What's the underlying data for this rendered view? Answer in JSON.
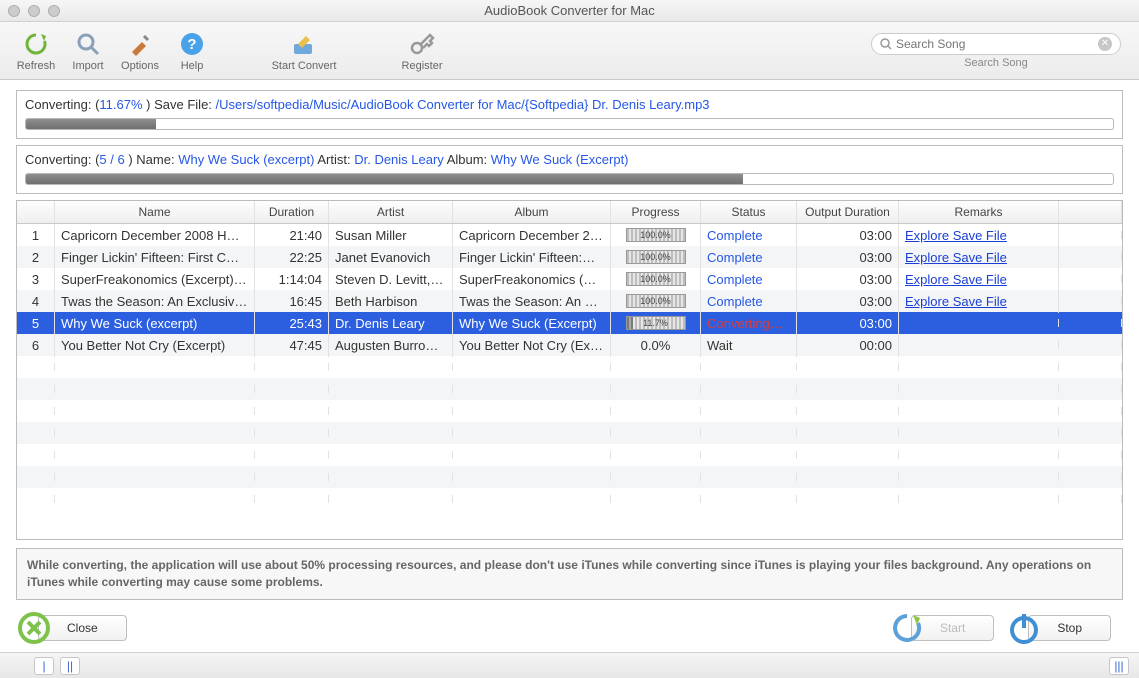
{
  "window": {
    "title": "AudioBook Converter for Mac"
  },
  "toolbar": {
    "refresh": "Refresh",
    "import": "Import",
    "options": "Options",
    "help": "Help",
    "start_convert": "Start Convert",
    "register": "Register"
  },
  "search": {
    "placeholder": "Search Song",
    "label": "Search Song"
  },
  "progress1": {
    "prefix": "Converting: (",
    "percent": "11.67%",
    "suffix": " ) Save File: ",
    "path": "/Users/softpedia/Music/AudioBook Converter for Mac/{Softpedia} Dr. Denis Leary.mp3",
    "bar_pct": 12
  },
  "progress2": {
    "prefix": "Converting: (",
    "count": "5 / 6",
    "suffix1": " )  Name: ",
    "name": "Why We Suck (excerpt)",
    "artist_label": "  Artist: ",
    "artist": "Dr. Denis Leary",
    "album_label": "  Album: ",
    "album": "Why We Suck (Excerpt)",
    "bar_pct": 66
  },
  "columns": {
    "idx": "",
    "name": "Name",
    "duration": "Duration",
    "artist": "Artist",
    "album": "Album",
    "progress": "Progress",
    "status": "Status",
    "output": "Output Duration",
    "remarks": "Remarks"
  },
  "rows": [
    {
      "idx": "1",
      "name": "Capricorn December 2008 H…",
      "dur": "21:40",
      "artist": "Susan Miller",
      "album": "Capricorn December 2…",
      "prog": "100.0%",
      "status": "Complete",
      "status_cls": "complete",
      "out": "03:00",
      "rem": "Explore Save File",
      "sel": false
    },
    {
      "idx": "2",
      "name": "Finger Lickin' Fifteen: First C…",
      "dur": "22:25",
      "artist": "Janet Evanovich",
      "album": "Finger Lickin' Fifteen:…",
      "prog": "100.0%",
      "status": "Complete",
      "status_cls": "complete",
      "out": "03:00",
      "rem": "Explore Save File",
      "sel": false
    },
    {
      "idx": "3",
      "name": "SuperFreakonomics (Excerpt)…",
      "dur": "1:14:04",
      "artist": "Steven D. Levitt,…",
      "album": "SuperFreakonomics (E…",
      "prog": "100.0%",
      "status": "Complete",
      "status_cls": "complete",
      "out": "03:00",
      "rem": "Explore Save File",
      "sel": false
    },
    {
      "idx": "4",
      "name": "Twas the Season: An Exclusiv…",
      "dur": "16:45",
      "artist": "Beth Harbison",
      "album": "Twas the Season: An E…",
      "prog": "100.0%",
      "status": "Complete",
      "status_cls": "complete",
      "out": "03:00",
      "rem": "Explore Save File",
      "sel": false
    },
    {
      "idx": "5",
      "name": "Why We Suck (excerpt)",
      "dur": "25:43",
      "artist": "Dr. Denis Leary",
      "album": "Why We Suck (Excerpt)",
      "prog": "11.7%",
      "status": "Converting…",
      "status_cls": "converting",
      "out": "03:00",
      "rem": "",
      "sel": true
    },
    {
      "idx": "6",
      "name": "You Better Not Cry (Excerpt)",
      "dur": "47:45",
      "artist": "Augusten Burro…",
      "album": "You Better Not Cry (Ex…",
      "prog": "0.0%",
      "status": "Wait",
      "status_cls": "wait",
      "out": "00:00",
      "rem": "",
      "sel": false
    }
  ],
  "warning": "While converting, the application will use about 50% processing resources, and please don't use iTunes while converting since iTunes is playing your files background. Any operations on iTunes while converting may cause some problems.",
  "buttons": {
    "close": "Close",
    "start": "Start",
    "stop": "Stop"
  }
}
